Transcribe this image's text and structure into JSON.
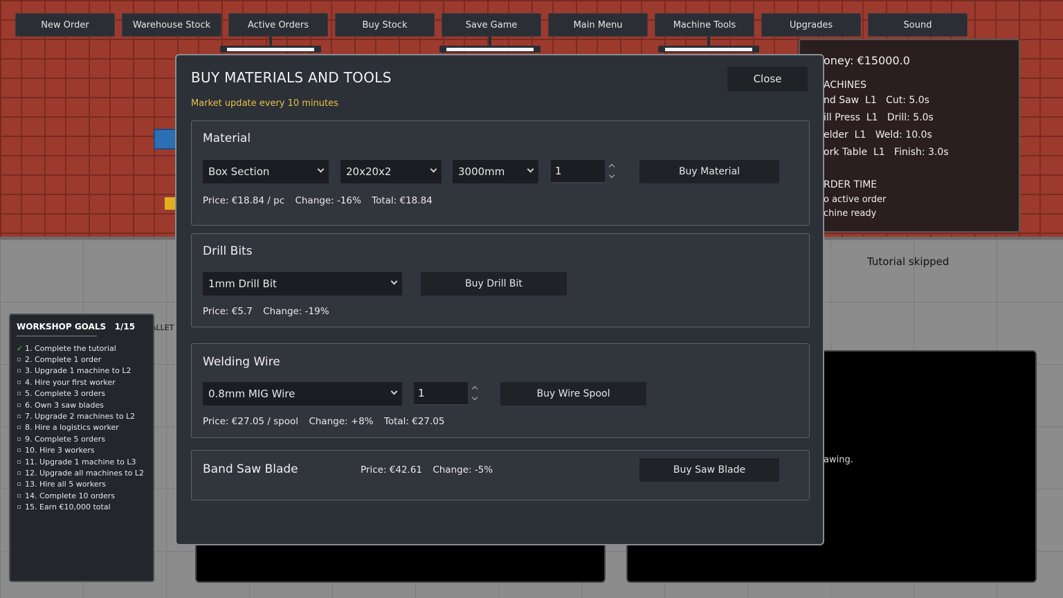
{
  "toolbar": [
    "New Order",
    "Warehouse Stock",
    "Active Orders",
    "Buy Stock",
    "Save Game",
    "Main Menu",
    "Machine Tools",
    "Upgrades",
    "Sound"
  ],
  "info": {
    "money": "oney: €15000.0",
    "machines_heading": "ACHINES",
    "machines": [
      "nd Saw  L1   Cut: 5.0s",
      "ill Press  L1   Drill: 5.0s",
      "elder  L1   Weld: 10.0s",
      "ork Table  L1   Finish: 3.0s"
    ],
    "order_heading": "RDER TIME",
    "order_lines": [
      "o active order",
      "chine ready"
    ]
  },
  "tutorial_note": "Tutorial skipped",
  "screen_text": "awing.",
  "pallet_label": "PALLET",
  "goals": {
    "title": "WORKSHOP GOALS   1/15",
    "items": [
      {
        "text": "1. Complete the tutorial",
        "done": true
      },
      {
        "text": "2. Complete 1 order",
        "done": false
      },
      {
        "text": "3. Upgrade 1 machine to L2",
        "done": false
      },
      {
        "text": "4. Hire your first worker",
        "done": false
      },
      {
        "text": "5. Complete 3 orders",
        "done": false
      },
      {
        "text": "6. Own 3 saw blades",
        "done": false
      },
      {
        "text": "7. Upgrade 2 machines to L2",
        "done": false
      },
      {
        "text": "8. Hire a logistics worker",
        "done": false
      },
      {
        "text": "9. Complete 5 orders",
        "done": false
      },
      {
        "text": "10. Hire 3 workers",
        "done": false
      },
      {
        "text": "11. Upgrade 1 machine to L3",
        "done": false
      },
      {
        "text": "12. Upgrade all machines to L2",
        "done": false
      },
      {
        "text": "13. Hire all 5 workers",
        "done": false
      },
      {
        "text": "14. Complete 10 orders",
        "done": false
      },
      {
        "text": "15. Earn €10,000 total",
        "done": false
      }
    ]
  },
  "modal": {
    "title": "BUY MATERIALS AND TOOLS",
    "subtitle": "Market update every 10 minutes",
    "close_label": "Close",
    "material": {
      "title": "Material",
      "type": "Box Section",
      "size": "20x20x2",
      "length": "3000mm",
      "qty": "1",
      "buy_label": "Buy Material",
      "price": "Price: €18.84 / pc",
      "change": "Change: -16%",
      "total": "Total: €18.84"
    },
    "drill": {
      "title": "Drill Bits",
      "type": "1mm Drill Bit",
      "buy_label": "Buy Drill Bit",
      "price": "Price: €5.7",
      "change": "Change: -19%"
    },
    "wire": {
      "title": "Welding Wire",
      "type": "0.8mm MIG Wire",
      "qty": "1",
      "buy_label": "Buy Wire Spool",
      "price": "Price: €27.05 / spool",
      "change": "Change: +8%",
      "total": "Total: €27.05"
    },
    "blade": {
      "title": "Band Saw Blade",
      "price": "Price: €42.61",
      "change": "Change: -5%",
      "buy_label": "Buy Saw Blade"
    }
  }
}
